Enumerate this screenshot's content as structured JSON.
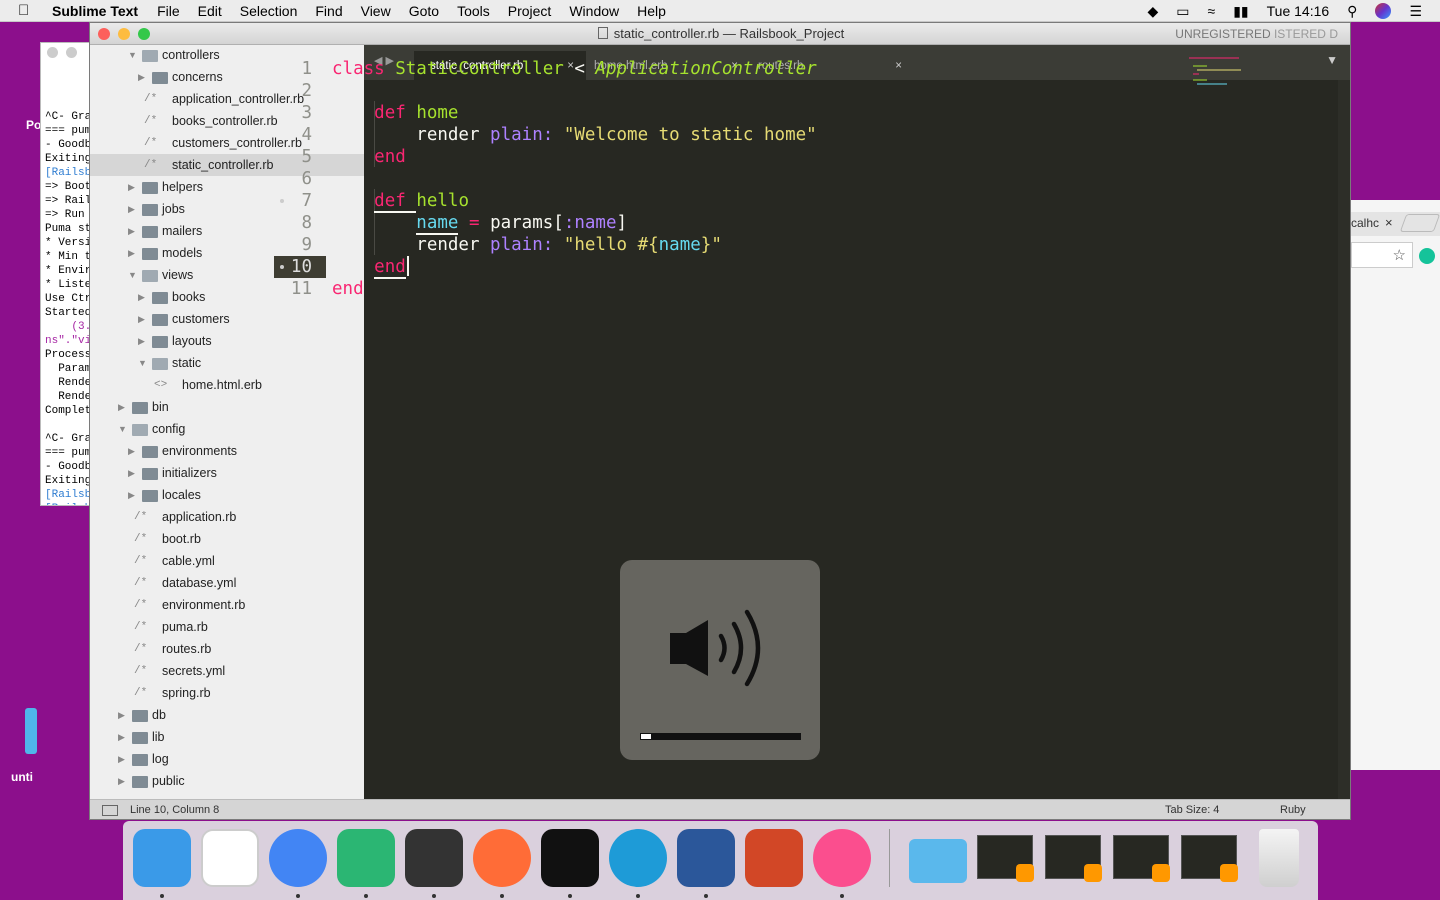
{
  "menubar": {
    "app_name": "Sublime Text",
    "items": [
      "File",
      "Edit",
      "Selection",
      "Find",
      "View",
      "Goto",
      "Tools",
      "Project",
      "Window",
      "Help"
    ],
    "clock": "Tue 14:16"
  },
  "background": {
    "terminal_lines": [
      "^C- Gra",
      "=== pum",
      "- Goodb",
      "Exiting",
      "[Railsbo",
      "=> Boot",
      "=> Rail",
      "=> Run",
      "Puma st",
      "* Versi",
      "* Min t",
      "* Envir",
      "* Liste",
      "Use Ctr",
      "Started",
      "    (3.",
      "ns\".\"vi",
      "Process",
      "  Param",
      "  Rende",
      "  Rende",
      "Complet",
      "",
      "^C- Gra",
      "=== pum",
      "- Goodb",
      "Exiting",
      "[Railsbo",
      "[Railsbo",
      "Railsbo"
    ],
    "left_label_top": "Po",
    "left_label_bottom": "unti",
    "chrome_tab": "calhc"
  },
  "window": {
    "title": "static_controller.rb — Railsbook_Project",
    "unregistered": "UNREGISTERED",
    "unregistered_behind": "ISTERED",
    "unregistered_behind2": "D"
  },
  "sidebar": {
    "items": [
      {
        "label": "controllers",
        "type": "folder",
        "open": true,
        "depth": 1
      },
      {
        "label": "concerns",
        "type": "folder",
        "open": false,
        "depth": 2
      },
      {
        "label": "application_controller.rb",
        "type": "file",
        "depth": 2
      },
      {
        "label": "books_controller.rb",
        "type": "file",
        "depth": 2
      },
      {
        "label": "customers_controller.rb",
        "type": "file",
        "depth": 2
      },
      {
        "label": "static_controller.rb",
        "type": "file",
        "depth": 2,
        "selected": true
      },
      {
        "label": "helpers",
        "type": "folder",
        "open": false,
        "depth": 1
      },
      {
        "label": "jobs",
        "type": "folder",
        "open": false,
        "depth": 1
      },
      {
        "label": "mailers",
        "type": "folder",
        "open": false,
        "depth": 1
      },
      {
        "label": "models",
        "type": "folder",
        "open": false,
        "depth": 1
      },
      {
        "label": "views",
        "type": "folder",
        "open": true,
        "depth": 1
      },
      {
        "label": "books",
        "type": "folder",
        "open": false,
        "depth": 2
      },
      {
        "label": "customers",
        "type": "folder",
        "open": false,
        "depth": 2
      },
      {
        "label": "layouts",
        "type": "folder",
        "open": false,
        "depth": 2
      },
      {
        "label": "static",
        "type": "folder",
        "open": true,
        "depth": 2
      },
      {
        "label": "home.html.erb",
        "type": "markup",
        "depth": 3
      },
      {
        "label": "bin",
        "type": "folder",
        "open": false,
        "depth": 0
      },
      {
        "label": "config",
        "type": "folder",
        "open": true,
        "depth": 0
      },
      {
        "label": "environments",
        "type": "folder",
        "open": false,
        "depth": 1
      },
      {
        "label": "initializers",
        "type": "folder",
        "open": false,
        "depth": 1
      },
      {
        "label": "locales",
        "type": "folder",
        "open": false,
        "depth": 1
      },
      {
        "label": "application.rb",
        "type": "file",
        "depth": 1
      },
      {
        "label": "boot.rb",
        "type": "file",
        "depth": 1
      },
      {
        "label": "cable.yml",
        "type": "file",
        "depth": 1
      },
      {
        "label": "database.yml",
        "type": "file",
        "depth": 1
      },
      {
        "label": "environment.rb",
        "type": "file",
        "depth": 1
      },
      {
        "label": "puma.rb",
        "type": "file",
        "depth": 1
      },
      {
        "label": "routes.rb",
        "type": "file",
        "depth": 1
      },
      {
        "label": "secrets.yml",
        "type": "file",
        "depth": 1
      },
      {
        "label": "spring.rb",
        "type": "file",
        "depth": 1
      },
      {
        "label": "db",
        "type": "folder",
        "open": false,
        "depth": 0
      },
      {
        "label": "lib",
        "type": "folder",
        "open": false,
        "depth": 0
      },
      {
        "label": "log",
        "type": "folder",
        "open": false,
        "depth": 0
      },
      {
        "label": "public",
        "type": "folder",
        "open": false,
        "depth": 0
      }
    ]
  },
  "tabs": [
    {
      "label": "static_controller.rb",
      "active": true
    },
    {
      "label": "home.html.erb",
      "active": false
    },
    {
      "label": "routes.rb",
      "active": false
    }
  ],
  "editor": {
    "current_line": 10,
    "modified_lines": [
      7,
      10
    ],
    "lines": [
      [
        [
          "class ",
          "kw"
        ],
        [
          "StaticController",
          "cn"
        ],
        [
          " < ",
          "pl"
        ],
        [
          "ApplicationController",
          "it"
        ]
      ],
      [],
      [
        [
          "    ",
          "pl"
        ],
        [
          "def ",
          "kw"
        ],
        [
          "home",
          "cn"
        ]
      ],
      [
        [
          "        render ",
          "pl"
        ],
        [
          "plain:",
          "sy"
        ],
        [
          " ",
          "pl"
        ],
        [
          "\"Welcome to static home\"",
          "st"
        ]
      ],
      [
        [
          "    ",
          "pl"
        ],
        [
          "end",
          "kw"
        ]
      ],
      [],
      [
        [
          "    ",
          "pl"
        ],
        [
          "def ",
          "kw"
        ],
        [
          "hello",
          "cn"
        ]
      ],
      [
        [
          "        ",
          "pl"
        ],
        [
          "name",
          "nm"
        ],
        [
          " = ",
          "kw"
        ],
        [
          "params",
          "pl"
        ],
        [
          "[",
          "pl"
        ],
        [
          ":name",
          "sy"
        ],
        [
          "]",
          "pl"
        ]
      ],
      [
        [
          "        render ",
          "pl"
        ],
        [
          "plain:",
          "sy"
        ],
        [
          " ",
          "pl"
        ],
        [
          "\"hello #{",
          "st"
        ],
        [
          "name",
          "nm"
        ],
        [
          "}\"",
          "st"
        ]
      ],
      [
        [
          "    ",
          "pl"
        ],
        [
          "end",
          "kw"
        ]
      ],
      [
        [
          "end",
          "kw"
        ]
      ]
    ]
  },
  "statusbar": {
    "position": "Line 10, Column 8",
    "tab_size": "Tab Size: 4",
    "syntax": "Ruby"
  },
  "volume_hud": {
    "level": 0.06
  },
  "dock": {
    "apps": [
      "Finder",
      "Slack",
      "Google Chrome",
      "Atom",
      "Sublime Text",
      "Postman",
      "Terminal",
      "MacDown",
      "Microsoft Word",
      "Microsoft PowerPoint",
      "iTunes"
    ],
    "running": [
      true,
      false,
      true,
      true,
      true,
      true,
      true,
      true,
      true,
      false,
      true
    ],
    "icon_colors": [
      "#3a9ae8",
      "#ffffff",
      "#4285f4",
      "#2bb673",
      "#333333",
      "#ff6c37",
      "#111111",
      "#1e9bd7",
      "#2b579a",
      "#d24726",
      "#fb4e8e"
    ],
    "right_items": [
      "Downloads",
      "Window",
      "Window",
      "Window",
      "Window",
      "Trash"
    ]
  }
}
